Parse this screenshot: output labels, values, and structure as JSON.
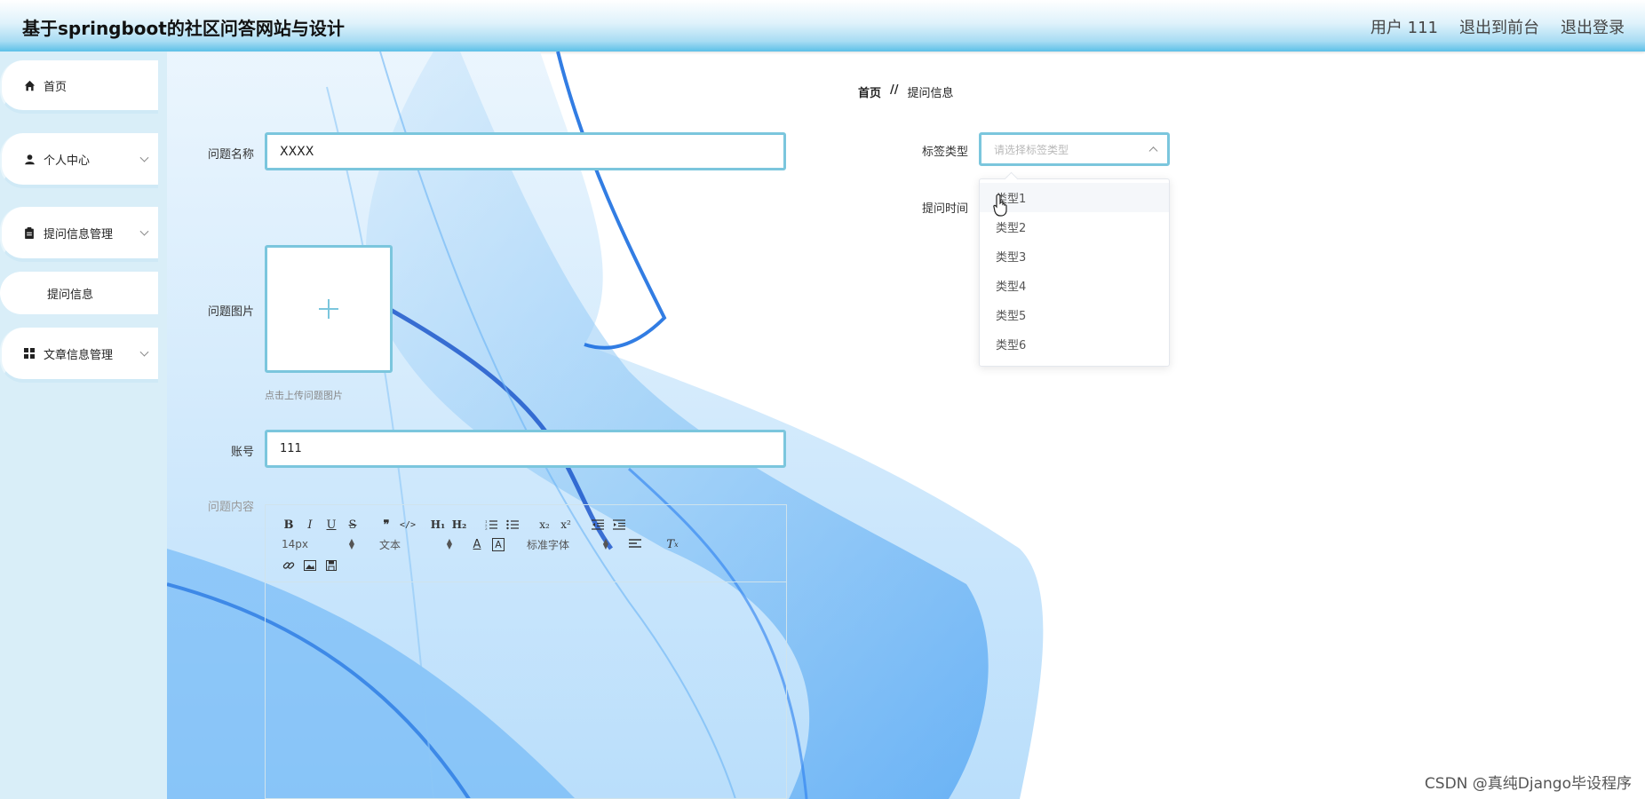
{
  "header": {
    "title": "基于springboot的社区问答网站与设计",
    "user_label": "用户 111",
    "back_to_front": "退出到前台",
    "logout": "退出登录"
  },
  "sidebar": {
    "items": [
      {
        "label": "首页",
        "icon": "home-icon"
      },
      {
        "label": "个人中心",
        "icon": "user-icon"
      },
      {
        "label": "提问信息管理",
        "icon": "clipboard-icon"
      },
      {
        "label": "提问信息",
        "icon": ""
      },
      {
        "label": "文章信息管理",
        "icon": "grid-icon"
      }
    ]
  },
  "breadcrumb": {
    "home": "首页",
    "separator": "//",
    "current": "提问信息"
  },
  "form": {
    "question_name_label": "问题名称",
    "question_name_value": "XXXX",
    "question_image_label": "问题图片",
    "upload_hint": "点击上传问题图片",
    "account_label": "账号",
    "account_value": "111",
    "content_label": "问题内容",
    "tag_type_label": "标签类型",
    "tag_type_placeholder": "请选择标签类型",
    "ask_time_label": "提问时间"
  },
  "editor": {
    "font_size": "14px",
    "text_style": "文本",
    "font_family": "标准字体"
  },
  "dropdown": {
    "options": [
      "类型1",
      "类型2",
      "类型3",
      "类型4",
      "类型5",
      "类型6"
    ]
  },
  "watermark": "CSDN @真纯Django毕设程序",
  "colors": {
    "accent": "#7bc6dd",
    "sidebar_bg": "#d9eef8",
    "header_gradient_end": "#5cc0e8"
  }
}
